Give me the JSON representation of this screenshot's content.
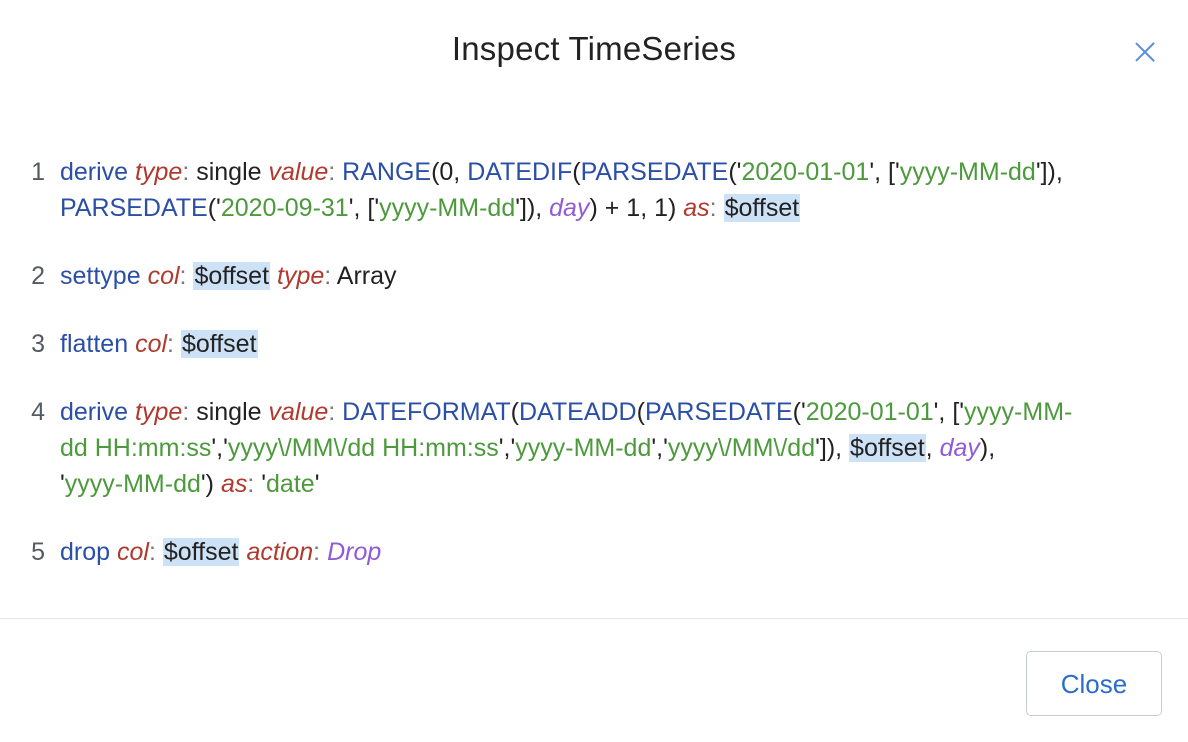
{
  "dialog": {
    "title": "Inspect TimeSeries",
    "close_icon": "close-x-icon",
    "close_button_label": "Close"
  },
  "steps": [
    {
      "number": "1",
      "lines": [
        [
          {
            "t": "derive",
            "c": "kw"
          },
          {
            "t": " "
          },
          {
            "t": "type",
            "c": "prm"
          },
          {
            "t": ":",
            "c": "punc"
          },
          {
            "t": " single",
            "c": "pln"
          },
          {
            "t": " "
          },
          {
            "t": "value",
            "c": "prm"
          },
          {
            "t": ":",
            "c": "punc"
          },
          {
            "t": " "
          },
          {
            "t": "RANGE",
            "c": "fn"
          },
          {
            "t": "(0, ",
            "c": "pln"
          },
          {
            "t": "DATEDIF",
            "c": "fn"
          },
          {
            "t": "(",
            "c": "pln"
          },
          {
            "t": "PARSEDATE",
            "c": "fn"
          },
          {
            "t": "('",
            "c": "pln"
          },
          {
            "t": "2020-01-01",
            "c": "str"
          },
          {
            "t": "', ['",
            "c": "pln"
          },
          {
            "t": "yyyy-MM-dd",
            "c": "str"
          },
          {
            "t": "']),",
            "c": "pln"
          }
        ],
        [
          {
            "t": "PARSEDATE",
            "c": "fn"
          },
          {
            "t": "('",
            "c": "pln"
          },
          {
            "t": "2020-09-31",
            "c": "str"
          },
          {
            "t": "', ['",
            "c": "pln"
          },
          {
            "t": "yyyy-MM-dd",
            "c": "str"
          },
          {
            "t": "']), ",
            "c": "pln"
          },
          {
            "t": "day",
            "c": "en"
          },
          {
            "t": ") + 1, 1) ",
            "c": "pln"
          },
          {
            "t": "as",
            "c": "prm"
          },
          {
            "t": ":",
            "c": "punc"
          },
          {
            "t": " "
          },
          {
            "t": "$offset",
            "c": "var"
          }
        ]
      ]
    },
    {
      "number": "2",
      "lines": [
        [
          {
            "t": "settype",
            "c": "kw"
          },
          {
            "t": " "
          },
          {
            "t": "col",
            "c": "prm"
          },
          {
            "t": ":",
            "c": "punc"
          },
          {
            "t": " "
          },
          {
            "t": "$offset",
            "c": "var"
          },
          {
            "t": " "
          },
          {
            "t": "type",
            "c": "prm"
          },
          {
            "t": ":",
            "c": "punc"
          },
          {
            "t": " Array",
            "c": "pln"
          }
        ]
      ]
    },
    {
      "number": "3",
      "lines": [
        [
          {
            "t": "flatten",
            "c": "kw"
          },
          {
            "t": " "
          },
          {
            "t": "col",
            "c": "prm"
          },
          {
            "t": ":",
            "c": "punc"
          },
          {
            "t": " "
          },
          {
            "t": "$offset",
            "c": "var"
          }
        ]
      ]
    },
    {
      "number": "4",
      "lines": [
        [
          {
            "t": "derive",
            "c": "kw"
          },
          {
            "t": " "
          },
          {
            "t": "type",
            "c": "prm"
          },
          {
            "t": ":",
            "c": "punc"
          },
          {
            "t": " single",
            "c": "pln"
          },
          {
            "t": " "
          },
          {
            "t": "value",
            "c": "prm"
          },
          {
            "t": ":",
            "c": "punc"
          },
          {
            "t": " "
          },
          {
            "t": "DATEFORMAT",
            "c": "fn"
          },
          {
            "t": "(",
            "c": "pln"
          },
          {
            "t": "DATEADD",
            "c": "fn"
          },
          {
            "t": "(",
            "c": "pln"
          },
          {
            "t": "PARSEDATE",
            "c": "fn"
          },
          {
            "t": "('",
            "c": "pln"
          },
          {
            "t": "2020-01-01",
            "c": "str"
          },
          {
            "t": "', ['",
            "c": "pln"
          },
          {
            "t": "yyyy-MM-",
            "c": "str"
          }
        ],
        [
          {
            "t": "dd HH:mm:ss",
            "c": "str"
          },
          {
            "t": "','",
            "c": "pln"
          },
          {
            "t": "yyyy\\/MM\\/dd HH:mm:ss",
            "c": "str"
          },
          {
            "t": "','",
            "c": "pln"
          },
          {
            "t": "yyyy-MM-dd",
            "c": "str"
          },
          {
            "t": "','",
            "c": "pln"
          },
          {
            "t": "yyyy\\/MM\\/dd",
            "c": "str"
          },
          {
            "t": "']), ",
            "c": "pln"
          },
          {
            "t": "$offset",
            "c": "var"
          },
          {
            "t": ", ",
            "c": "pln"
          },
          {
            "t": "day",
            "c": "en"
          },
          {
            "t": "),",
            "c": "pln"
          }
        ],
        [
          {
            "t": "'",
            "c": "pln"
          },
          {
            "t": "yyyy-MM-dd",
            "c": "str"
          },
          {
            "t": "') ",
            "c": "pln"
          },
          {
            "t": "as",
            "c": "prm"
          },
          {
            "t": ":",
            "c": "punc"
          },
          {
            "t": " '",
            "c": "pln"
          },
          {
            "t": "date",
            "c": "str"
          },
          {
            "t": "'",
            "c": "pln"
          }
        ]
      ]
    },
    {
      "number": "5",
      "lines": [
        [
          {
            "t": "drop",
            "c": "kw"
          },
          {
            "t": " "
          },
          {
            "t": "col",
            "c": "prm"
          },
          {
            "t": ":",
            "c": "punc"
          },
          {
            "t": " "
          },
          {
            "t": "$offset",
            "c": "var"
          },
          {
            "t": " "
          },
          {
            "t": "action",
            "c": "prm"
          },
          {
            "t": ":",
            "c": "punc"
          },
          {
            "t": " "
          },
          {
            "t": "Drop",
            "c": "en"
          }
        ]
      ]
    }
  ]
}
